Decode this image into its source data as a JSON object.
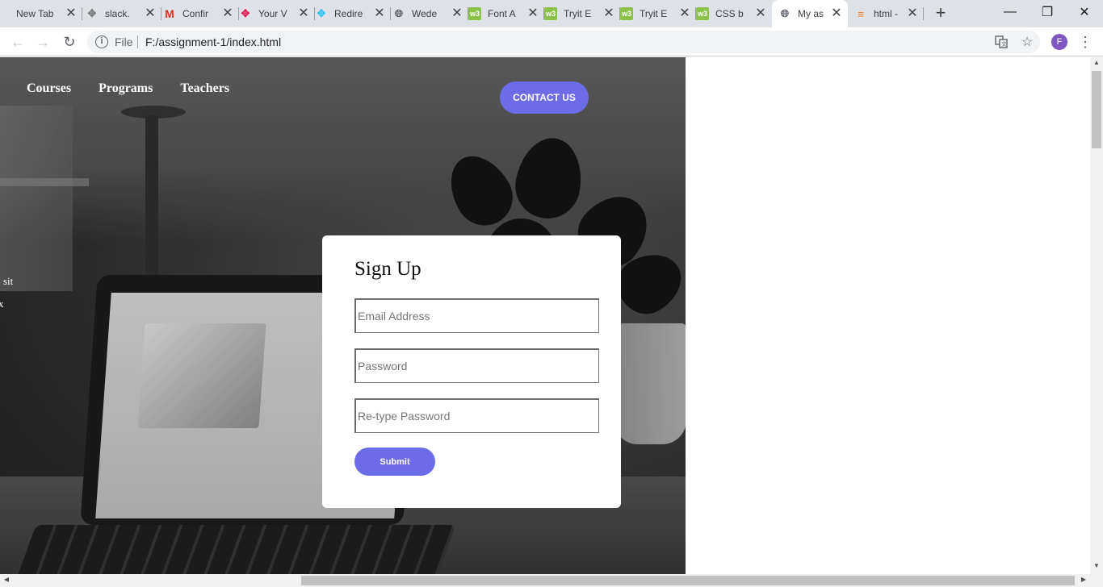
{
  "browser": {
    "tabs": [
      {
        "title": "New Tab",
        "icon": "none"
      },
      {
        "title": "slack.",
        "icon": "slack-icon"
      },
      {
        "title": "Confir",
        "icon": "gmail-icon"
      },
      {
        "title": "Your V",
        "icon": "slack-icon"
      },
      {
        "title": "Redire",
        "icon": "slack-icon"
      },
      {
        "title": "Wede",
        "icon": "globe-icon"
      },
      {
        "title": "Font A",
        "icon": "w3schools-icon"
      },
      {
        "title": "Tryit E",
        "icon": "w3schools-icon"
      },
      {
        "title": "Tryit E",
        "icon": "w3schools-icon"
      },
      {
        "title": "CSS b",
        "icon": "w3schools-icon"
      },
      {
        "title": "My as",
        "icon": "globe-icon",
        "active": true
      },
      {
        "title": "html -",
        "icon": "stackoverflow-icon"
      }
    ],
    "new_tab_symbol": "+",
    "close_symbol": "✕",
    "window_controls": {
      "minimize": "—",
      "maximize": "❐",
      "close": "✕"
    },
    "nav": {
      "back": "←",
      "forward": "→",
      "reload": "↻"
    },
    "omnibox": {
      "info": "i",
      "scheme_label": "File",
      "url": "F:/assignment-1/index.html"
    },
    "profile_initial": "F",
    "menu_symbol": "⋮",
    "colors": {
      "tabstrip": "#dee1e6",
      "profile": "#7e57c2"
    }
  },
  "page": {
    "nav_links": [
      "Courses",
      "Programs",
      "Teachers"
    ],
    "contact_button": "CONTACT US",
    "side_snippet": [
      "sit",
      "x"
    ],
    "signup": {
      "title": "Sign Up",
      "email_placeholder": "Email Address",
      "password_placeholder": "Password",
      "retype_placeholder": "Re-type Password",
      "submit_label": "Submit"
    },
    "colors": {
      "accent": "#6c6ce8",
      "card": "#ffffff"
    }
  }
}
